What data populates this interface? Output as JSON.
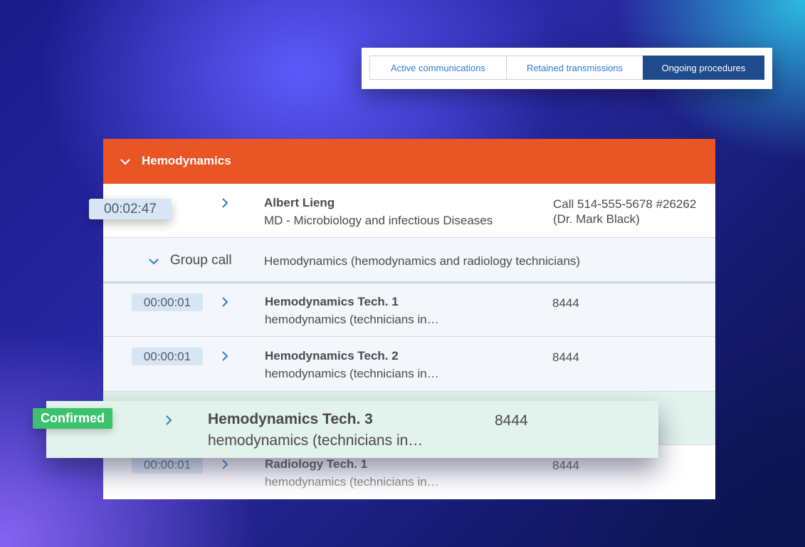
{
  "tabs": [
    {
      "label": "Active communications",
      "active": false
    },
    {
      "label": "Retained transmissions",
      "active": false
    },
    {
      "label": "Ongoing procedures",
      "active": true
    }
  ],
  "section": {
    "title": "Hemodynamics",
    "color": "#e95525"
  },
  "first_row": {
    "timer": "00:02:47",
    "name": "Albert Lieng",
    "role": "MD - Microbiology and infectious Diseases",
    "call_line1": "Call 514-555-5678 #26262",
    "call_line2": "(Dr. Mark Black)"
  },
  "group": {
    "label": "Group call",
    "description": "Hemodynamics (hemodynamics and radiology technicians)"
  },
  "members": [
    {
      "timer": "00:00:01",
      "name": "Hemodynamics Tech. 1",
      "sub": "hemodynamics (technicians in…",
      "ext": "8444"
    },
    {
      "timer": "00:00:01",
      "name": "Hemodynamics Tech. 2",
      "sub": "hemodynamics (technicians in…",
      "ext": "8444"
    },
    {
      "timer": "00:00:01",
      "name": "Radiology Tech. 1",
      "sub": "hemodynamics (technicians in…",
      "ext": "8444"
    }
  ],
  "confirmed_card": {
    "badge": "Confirmed",
    "name": "Hemodynamics Tech. 3",
    "sub": "hemodynamics (technicians in…",
    "ext": "8444",
    "badge_color": "#3cc26d"
  },
  "icons": {
    "arrow": "chevron-right-icon",
    "expand": "chevron-down-icon"
  }
}
